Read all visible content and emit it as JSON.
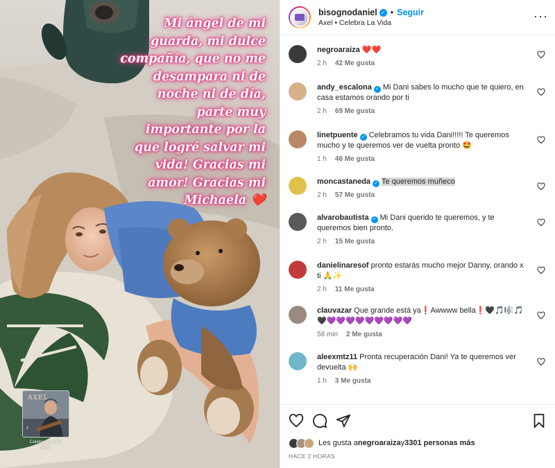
{
  "photo": {
    "caption_lines": [
      "Mi ángel de mi",
      "guarda, mi dulce",
      "compañía, que no me",
      "desampara  ni de",
      "noche ni de día,",
      "parte muy",
      "importante por la",
      "que logré salvar  mi",
      "vida! Gracias mi",
      "amor! Gracias mi",
      "Michaela"
    ],
    "caption_emoji": "❤️",
    "music": {
      "art_title": "AXEL",
      "song": "Celebra La Vida",
      "artist": "Axel"
    }
  },
  "header": {
    "username": "bisognodaniel",
    "follow_label": "Seguir",
    "separator": "•",
    "subtitle": "Axel • Celebra La Vida",
    "more_label": "···"
  },
  "comments": [
    {
      "user": "negroaraiza",
      "verified": false,
      "text": "❤️❤️",
      "time": "2 h",
      "likes": "42 Me gusta",
      "avatar": "#3a3a3a"
    },
    {
      "user": "andy_escalona",
      "verified": true,
      "text": "Mi Dani sabes lo mucho que te quiero, en casa estamos orando por ti",
      "time": "2 h",
      "likes": "69 Me gusta",
      "avatar": "#d8b08a"
    },
    {
      "user": "linetpuente",
      "verified": true,
      "text": "Celebramos tu vida Dani!!!!! Te queremos mucho y te queremos ver de vuelta pronto 🤩",
      "time": "1 h",
      "likes": "46 Me gusta",
      "avatar": "#b98866"
    },
    {
      "user": "moncastaneda",
      "verified": true,
      "text": "Te queremos muñeco",
      "time": "2 h",
      "likes": "57 Me gusta",
      "avatar": "#e0c24a"
    },
    {
      "user": "alvarobautista",
      "verified": true,
      "text": "Mi Dani querido te queremos, y te queremos bien pronto.",
      "time": "2 h",
      "likes": "15 Me gusta",
      "avatar": "#5a5a5a"
    },
    {
      "user": "danielinaresof",
      "verified": false,
      "text": "pronto estarás mucho mejor Danny, orando x ti 🙏✨",
      "time": "2 h",
      "likes": "11 Me gusta",
      "avatar": "#c23a3a"
    },
    {
      "user": "clauvazar",
      "verified": false,
      "text": "Que grande está ya❗Awwww bella❗🖤🎵🎼🎵🖤💜💜💜💜💜💜💜💜💜",
      "time": "58 min",
      "likes": "2 Me gusta",
      "avatar": "#9a8a80"
    },
    {
      "user": "aleexmtz11",
      "verified": false,
      "text": "Pronta recuperación Dani! Ya te queremos ver devuelta 🙌",
      "time": "1 h",
      "likes": "3 Me gusta",
      "avatar": "#6fb7c9"
    }
  ],
  "likes_summary": {
    "prefix": "Les gusta a ",
    "user": "negroaraiza",
    "middle": " y ",
    "count": "3301 personas más"
  },
  "time_ago": "HACE 2 HORAS",
  "colors": {
    "accent": "#0095f6",
    "caption_glow": "#e0347a",
    "muted": "#737373"
  }
}
